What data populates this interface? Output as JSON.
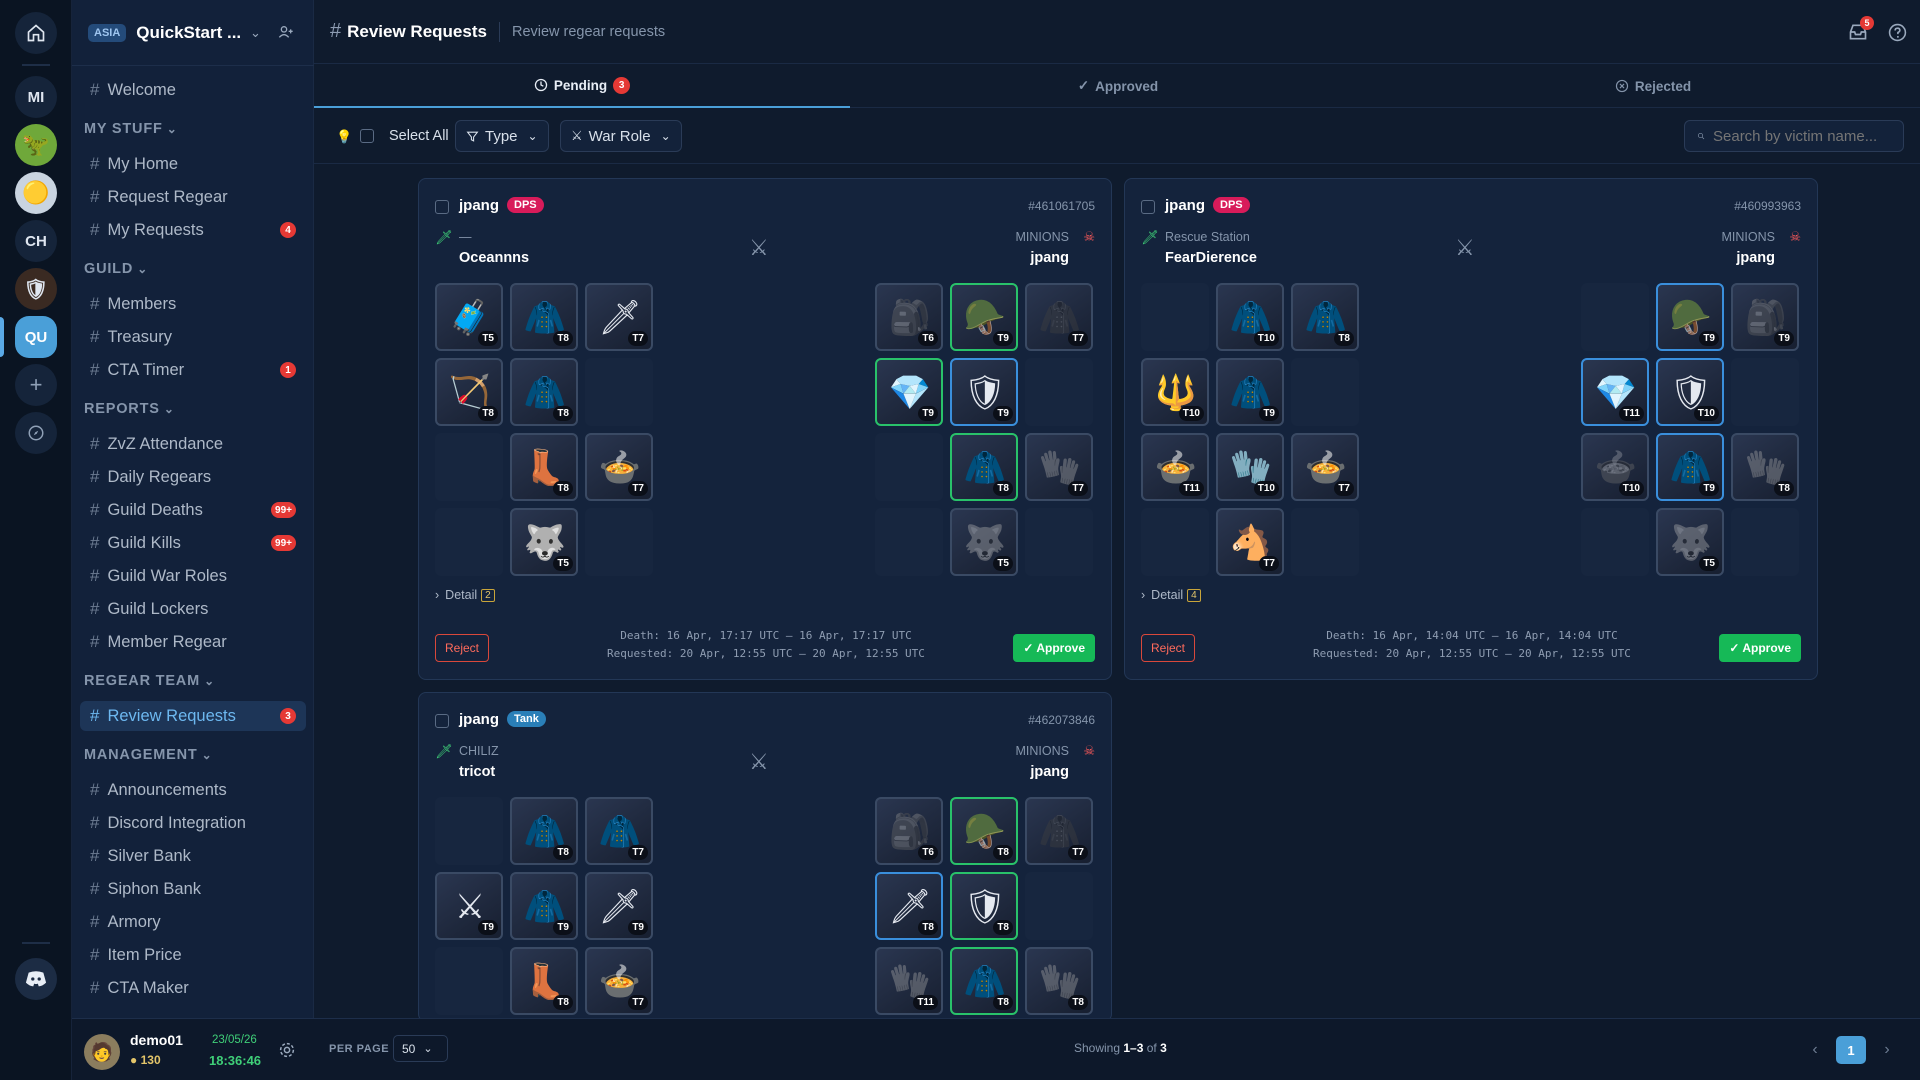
{
  "rail": {
    "items": [
      {
        "label": "MI"
      },
      {
        "label": "CH"
      },
      {
        "label": "QU"
      }
    ]
  },
  "workspace": {
    "region": "ASIA",
    "name": "QuickStart ..."
  },
  "sidebar": {
    "top": [
      {
        "label": "Welcome"
      }
    ],
    "sections": [
      {
        "title": "MY STUFF",
        "items": [
          {
            "label": "My Home"
          },
          {
            "label": "Request Regear"
          },
          {
            "label": "My Requests",
            "badge": "4"
          }
        ]
      },
      {
        "title": "GUILD",
        "items": [
          {
            "label": "Members"
          },
          {
            "label": "Treasury"
          },
          {
            "label": "CTA Timer",
            "badge": "1"
          }
        ]
      },
      {
        "title": "REPORTS",
        "items": [
          {
            "label": "ZvZ Attendance"
          },
          {
            "label": "Daily Regears"
          },
          {
            "label": "Guild Deaths",
            "badge": "99+"
          },
          {
            "label": "Guild Kills",
            "badge": "99+"
          },
          {
            "label": "Guild War Roles"
          },
          {
            "label": "Guild Lockers"
          },
          {
            "label": "Member Regear"
          }
        ]
      },
      {
        "title": "REGEAR TEAM",
        "items": [
          {
            "label": "Review Requests",
            "badge": "3",
            "active": true
          }
        ]
      },
      {
        "title": "MANAGEMENT",
        "items": [
          {
            "label": "Announcements"
          },
          {
            "label": "Discord Integration"
          },
          {
            "label": "Silver Bank"
          },
          {
            "label": "Siphon Bank"
          },
          {
            "label": "Armory"
          },
          {
            "label": "Item Price"
          },
          {
            "label": "CTA Maker"
          }
        ]
      }
    ]
  },
  "user": {
    "name": "demo01",
    "silver": "130",
    "date": "23/05/26",
    "time": "18:36:46"
  },
  "header": {
    "title": "Review Requests",
    "subtitle": "Review regear requests",
    "notif_count": "5"
  },
  "tabs": {
    "pending": {
      "label": "Pending",
      "count": "3"
    },
    "approved": {
      "label": "Approved"
    },
    "rejected": {
      "label": "Rejected"
    }
  },
  "filters": {
    "select_all": "Select All",
    "type": "Type",
    "war_role": "War Role",
    "search_placeholder": "Search by victim name..."
  },
  "cards": [
    {
      "player": "jpang",
      "role": "DPS",
      "role_color": "#d81b5a",
      "id": "#461061705",
      "killer_guild": "—",
      "killer": "Oceannns",
      "victim_guild": "MINIONS",
      "victim": "jpang",
      "detail_label": "Detail",
      "detail_count": "2",
      "death": "Death: 16 Apr, 17:17 UTC – 16 Apr, 17:17 UTC",
      "requested": "Requested: 20 Apr, 12:55 UTC – 20 Apr, 12:55 UTC",
      "reject": "Reject",
      "approve": "✓ Approve",
      "killer_items": [
        [
          "T5",
          "🧳",
          "o"
        ],
        [
          "T8",
          "🧥",
          "o"
        ],
        [
          "T7",
          "🗡",
          "o"
        ],
        [
          "T8",
          "🏹",
          "o"
        ],
        [
          "T8",
          "🧥",
          "o"
        ],
        [
          "",
          ""
        ],
        [
          "",
          ""
        ],
        [
          "T8",
          "👢",
          "o"
        ],
        [
          "T7",
          "🍲",
          "o"
        ],
        [
          "",
          ""
        ],
        [
          "T5",
          "🐺",
          "o"
        ],
        [
          "",
          ""
        ]
      ],
      "victim_items": [
        [
          "T6",
          "🎒",
          "d"
        ],
        [
          "T9",
          "🪖",
          "g"
        ],
        [
          "T7",
          "🧥",
          "d"
        ],
        [
          "T9",
          "💎",
          "g"
        ],
        [
          "T9",
          "🛡",
          "b"
        ],
        [
          "",
          ""
        ],
        [
          "",
          ""
        ],
        [
          "T8",
          "🧥",
          "g"
        ],
        [
          "T7",
          "🧤",
          "d"
        ],
        [
          "",
          ""
        ],
        [
          "T5",
          "🐺",
          "d"
        ],
        [
          "",
          ""
        ]
      ]
    },
    {
      "player": "jpang",
      "role": "DPS",
      "role_color": "#d81b5a",
      "id": "#460993963",
      "killer_guild": "Rescue Station",
      "killer": "FearDierence",
      "victim_guild": "MINIONS",
      "victim": "jpang",
      "detail_label": "Detail",
      "detail_count": "4",
      "death": "Death: 16 Apr, 14:04 UTC – 16 Apr, 14:04 UTC",
      "requested": "Requested: 20 Apr, 12:55 UTC – 20 Apr, 12:55 UTC",
      "reject": "Reject",
      "approve": "✓ Approve",
      "killer_items": [
        [
          "",
          ""
        ],
        [
          "T10",
          "🧥",
          "o"
        ],
        [
          "T8",
          "🧥",
          "o"
        ],
        [
          "T10",
          "🔱",
          "o"
        ],
        [
          "T9",
          "🧥",
          "o"
        ],
        [
          "",
          ""
        ],
        [
          "T11",
          "🍲",
          "o"
        ],
        [
          "T10",
          "🧤",
          "o"
        ],
        [
          "T7",
          "🍲",
          "o"
        ],
        [
          "",
          ""
        ],
        [
          "T7",
          "🐴",
          "o"
        ],
        [
          "",
          ""
        ]
      ],
      "victim_items": [
        [
          "",
          ""
        ],
        [
          "T9",
          "🪖",
          "b"
        ],
        [
          "T9",
          "🎒",
          "d"
        ],
        [
          "T11",
          "💎",
          "b"
        ],
        [
          "T10",
          "🛡",
          "b"
        ],
        [
          "",
          ""
        ],
        [
          "T10",
          "🍲",
          "d"
        ],
        [
          "T9",
          "🧥",
          "b"
        ],
        [
          "T8",
          "🧤",
          "d"
        ],
        [
          "",
          ""
        ],
        [
          "T5",
          "🐺",
          "d"
        ],
        [
          "",
          ""
        ]
      ]
    },
    {
      "player": "jpang",
      "role": "Tank",
      "role_color": "#2a7fb8",
      "id": "#462073846",
      "killer_guild": "CHILIZ",
      "killer": "tricot",
      "victim_guild": "MINIONS",
      "victim": "jpang",
      "killer_items": [
        [
          "",
          ""
        ],
        [
          "T8",
          "🧥",
          "o"
        ],
        [
          "T7",
          "🧥",
          "o"
        ],
        [
          "T9",
          "⚔",
          "o"
        ],
        [
          "T9",
          "🧥",
          "o"
        ],
        [
          "T9",
          "🗡",
          "o"
        ],
        [
          "",
          ""
        ],
        [
          "T8",
          "👢",
          "o"
        ],
        [
          "T7",
          "🍲",
          "o"
        ]
      ],
      "victim_items": [
        [
          "T6",
          "🎒",
          "d"
        ],
        [
          "T8",
          "🪖",
          "g"
        ],
        [
          "T7",
          "🧥",
          "d"
        ],
        [
          "T8",
          "🗡",
          "b"
        ],
        [
          "T8",
          "🛡",
          "g"
        ],
        [
          "",
          ""
        ],
        [
          "T11",
          "🧤",
          "d"
        ],
        [
          "T8",
          "🧥",
          "g"
        ],
        [
          "T8",
          "🧤",
          "d"
        ]
      ]
    }
  ],
  "footer": {
    "per_page_label": "PER PAGE",
    "per_page": "50",
    "showing_prefix": "Showing ",
    "showing_range": "1–3",
    "showing_mid": " of ",
    "showing_total": "3",
    "page": "1"
  }
}
